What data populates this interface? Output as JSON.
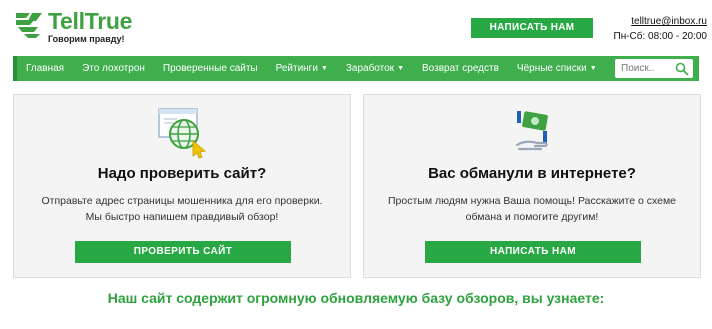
{
  "brand": {
    "name_part1": "Tell",
    "name_part2": "True",
    "tagline": "Говорим правду!"
  },
  "header": {
    "write_button": "НАПИСАТЬ НАМ",
    "email": "telltrue@inbox.ru",
    "hours": "Пн-Сб: 08:00 - 20:00"
  },
  "nav": {
    "items": [
      {
        "label": "Главная",
        "dropdown": false
      },
      {
        "label": "Это лохотрон",
        "dropdown": false
      },
      {
        "label": "Проверенные сайты",
        "dropdown": false
      },
      {
        "label": "Рейтинги",
        "dropdown": true
      },
      {
        "label": "Заработок",
        "dropdown": true
      },
      {
        "label": "Возврат средств",
        "dropdown": false
      },
      {
        "label": "Чёрные списки",
        "dropdown": true
      }
    ],
    "caret": "▼",
    "search_placeholder": "Поиск.."
  },
  "cards": [
    {
      "icon": "globe-check-icon",
      "title": "Надо проверить сайт?",
      "text": "Отправьте адрес страницы мошенника для его проверки. Мы быстро напишем правдивый обзор!",
      "button": "ПРОВЕРИТЬ САЙТ"
    },
    {
      "icon": "money-hand-icon",
      "title": "Вас обманули в интернете?",
      "text": "Простым людям нужна Ваша помощь! Расскажите о схеме обмана и помогите другим!",
      "button": "НАПИСАТЬ НАМ"
    }
  ],
  "bottom_heading": "Наш сайт содержит огромную обновляемую базу обзоров, вы узнаете:",
  "colors": {
    "brand_green": "#3fa142",
    "button_green": "#27a844",
    "nav_green": "#3fae4d",
    "heading_green": "#2fa23f"
  }
}
